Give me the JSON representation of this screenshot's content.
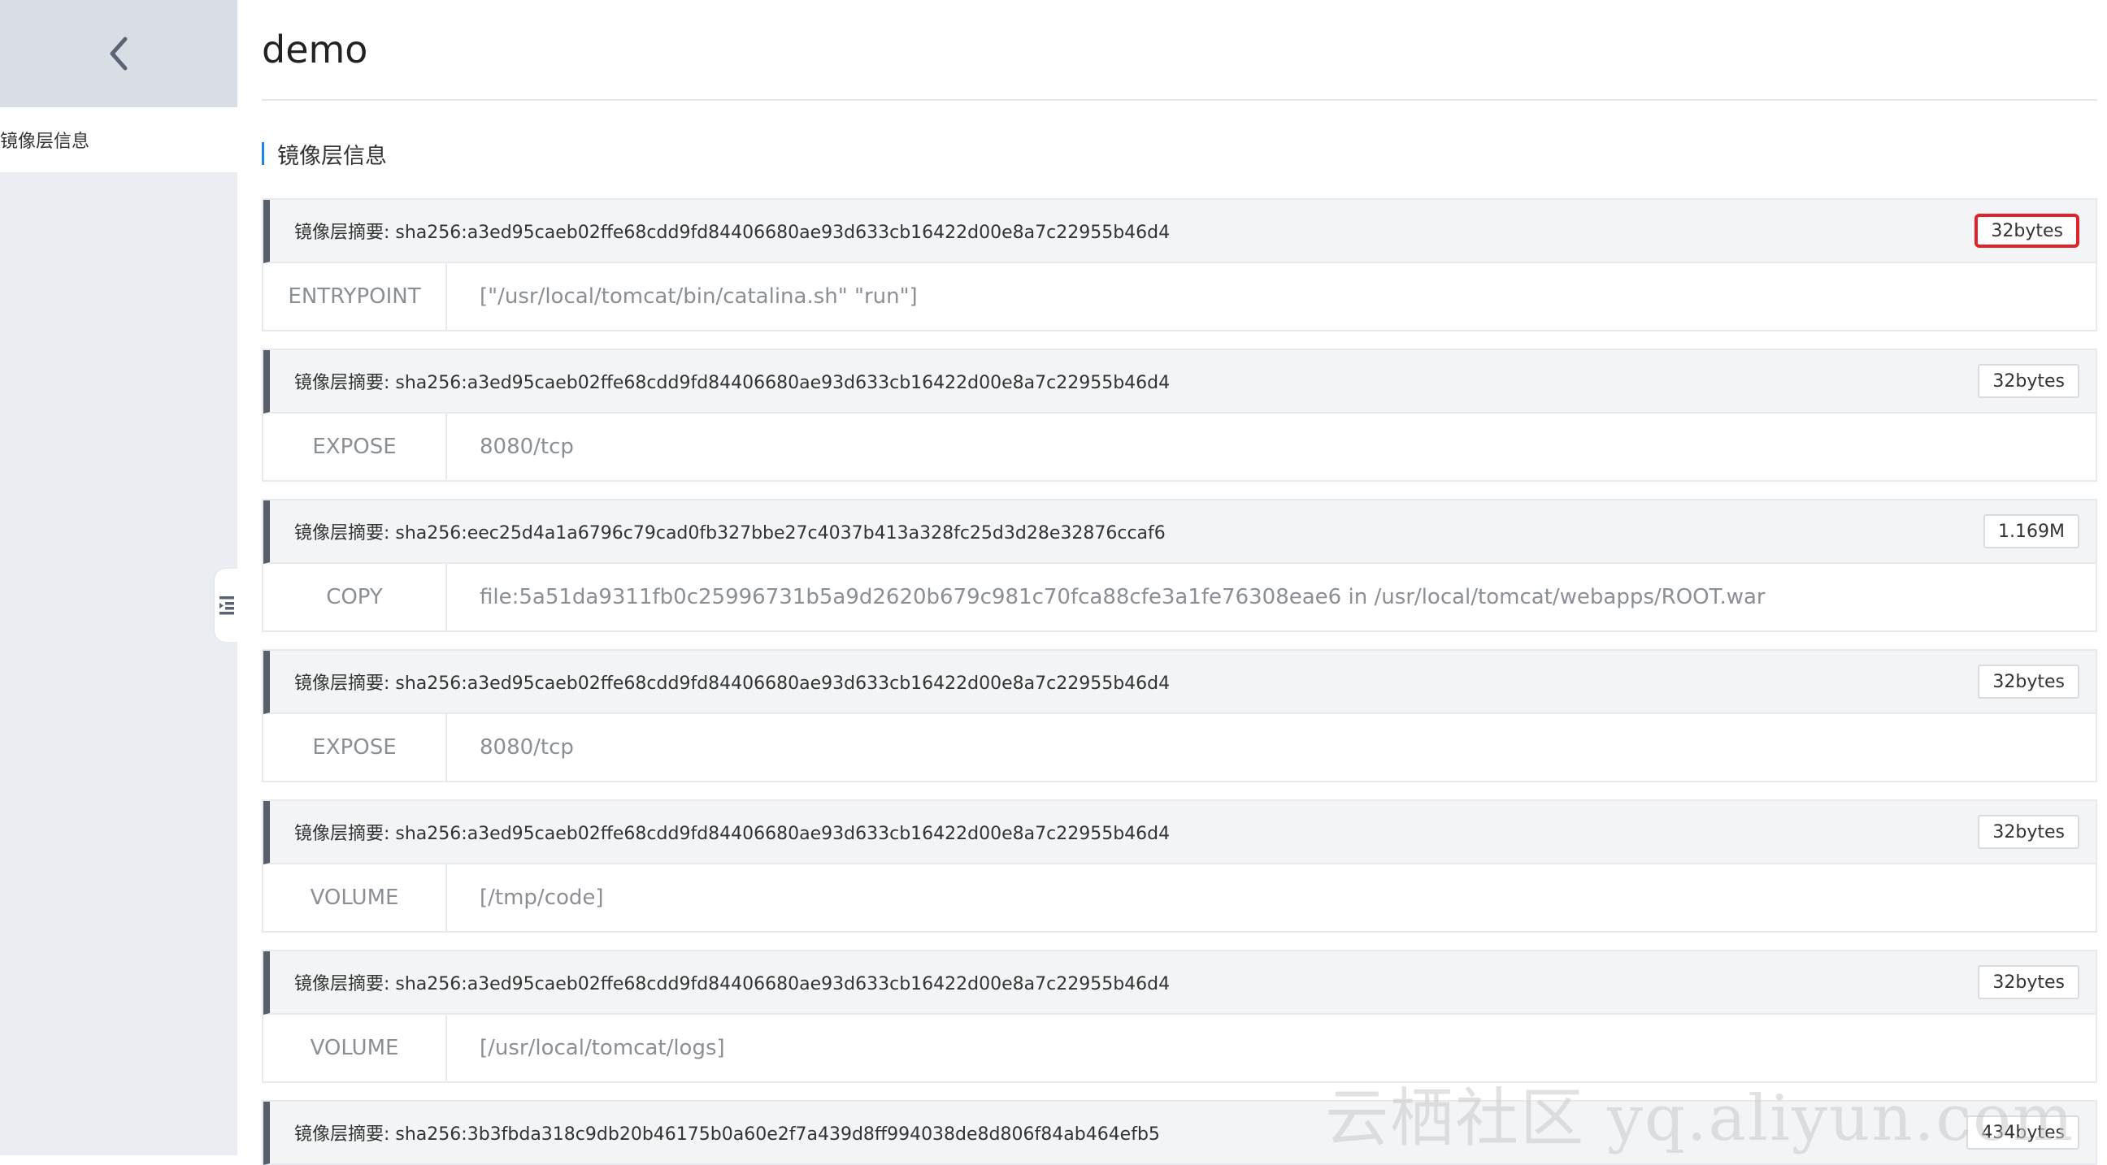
{
  "sidebar": {
    "back_icon": "chevron-left-icon",
    "items": [
      {
        "label": "镜像层信息"
      }
    ],
    "collapse_icon": "collapse-sidebar-icon"
  },
  "page": {
    "title": "demo"
  },
  "section": {
    "title": "镜像层信息"
  },
  "layers": [
    {
      "digest": "镜像层摘要: sha256:a3ed95caeb02ffe68cdd9fd84406680ae93d633cb16422d00e8a7c22955b46d4",
      "size": "32bytes",
      "command": "ENTRYPOINT",
      "argument": "[\"/usr/local/tomcat/bin/catalina.sh\" \"run\"]"
    },
    {
      "digest": "镜像层摘要: sha256:a3ed95caeb02ffe68cdd9fd84406680ae93d633cb16422d00e8a7c22955b46d4",
      "size": "32bytes",
      "command": "EXPOSE",
      "argument": "8080/tcp"
    },
    {
      "digest": "镜像层摘要: sha256:eec25d4a1a6796c79cad0fb327bbe27c4037b413a328fc25d3d28e32876ccaf6",
      "size": "1.169M",
      "command": "COPY",
      "argument": "file:5a51da9311fb0c25996731b5a9d2620b679c981c70fca88cfe3a1fe76308eae6 in /usr/local/tomcat/webapps/ROOT.war"
    },
    {
      "digest": "镜像层摘要: sha256:a3ed95caeb02ffe68cdd9fd84406680ae93d633cb16422d00e8a7c22955b46d4",
      "size": "32bytes",
      "command": "EXPOSE",
      "argument": "8080/tcp"
    },
    {
      "digest": "镜像层摘要: sha256:a3ed95caeb02ffe68cdd9fd84406680ae93d633cb16422d00e8a7c22955b46d4",
      "size": "32bytes",
      "command": "VOLUME",
      "argument": "[/tmp/code]"
    },
    {
      "digest": "镜像层摘要: sha256:a3ed95caeb02ffe68cdd9fd84406680ae93d633cb16422d00e8a7c22955b46d4",
      "size": "32bytes",
      "command": "VOLUME",
      "argument": "[/usr/local/tomcat/logs]"
    },
    {
      "digest": "镜像层摘要: sha256:3b3fbda318c9db20b46175b0a60e2f7a439d8ff994038de8d806f84ab464efb5",
      "size": "434bytes"
    }
  ],
  "watermark": "云栖社区 yq.aliyun.com",
  "colors": {
    "accent": "#1e84e8",
    "highlight": "#e0232b",
    "sidebar_bg": "#eaedf1"
  }
}
